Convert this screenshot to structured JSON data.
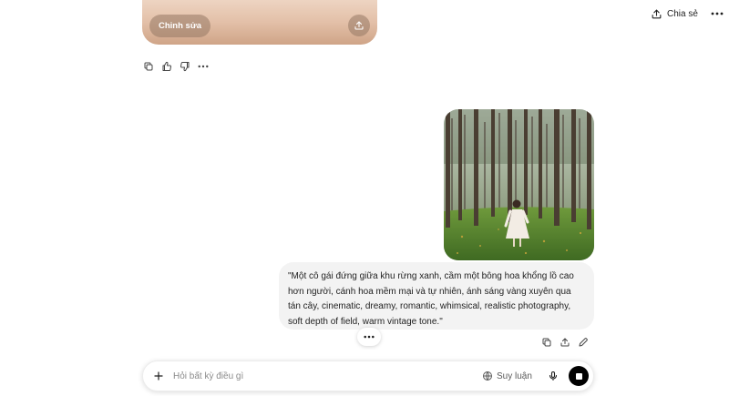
{
  "header": {
    "share_label": "Chia sẻ",
    "share_icon": "share-icon",
    "more_icon": "more-icon"
  },
  "previous_image": {
    "edit_label": "Chỉnh sửa",
    "upload_icon": "upload-icon"
  },
  "response_actions": [
    "copy-icon",
    "thumbs-up-icon",
    "thumbs-down-icon",
    "more-icon"
  ],
  "user_message": {
    "text": "\"Một cô gái đứng giữa khu rừng xanh, cầm một bông hoa khổng lồ cao hơn người, cánh hoa mềm mại và tự nhiên, ánh sáng vàng xuyên qua tán cây, cinematic, dreamy, romantic, whimsical, realistic photography, soft depth of field, warm vintage tone.\"",
    "actions": [
      "copy-icon",
      "share-icon",
      "edit-icon"
    ]
  },
  "composer": {
    "placeholder": "Hỏi bất kỳ điều gì",
    "reason_label": "Suy luận",
    "icons": [
      "plus-icon",
      "globe-icon",
      "mic-icon",
      "stop-icon"
    ]
  },
  "colors": {
    "bubble_bg": "#f3f3f3",
    "accent": "#000000",
    "image_tint": "#e3c0a8"
  }
}
